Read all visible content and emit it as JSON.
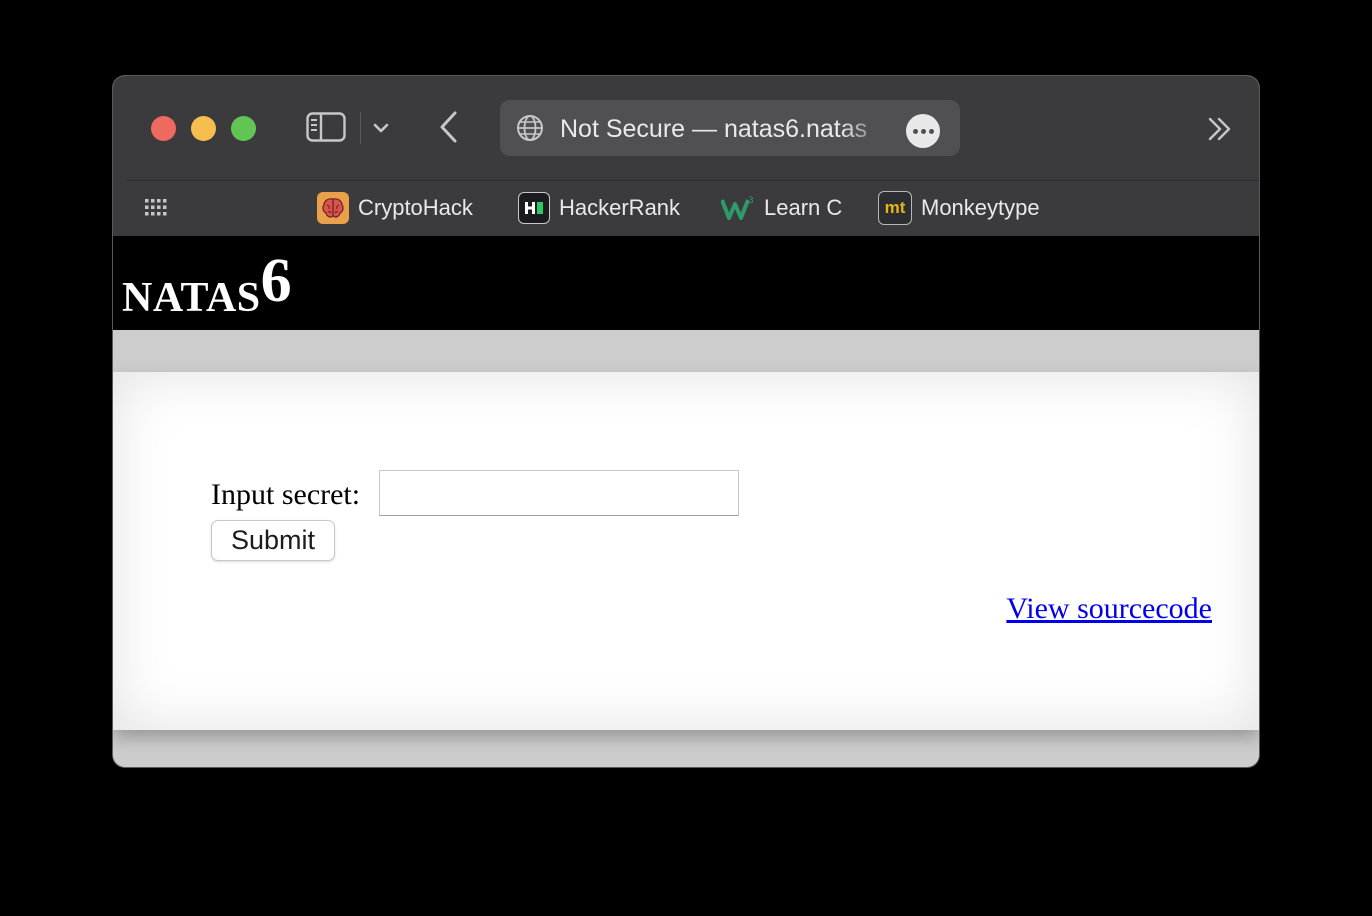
{
  "browser": {
    "address_text": "Not Secure — natas6.natas",
    "bookmarks": [
      {
        "label": "CryptoHack",
        "icon": "cryptohack-favicon"
      },
      {
        "label": "HackerRank",
        "icon": "hackerrank-favicon"
      },
      {
        "label": "Learn C",
        "icon": "learn-c-favicon"
      },
      {
        "label": "Monkeytype",
        "icon": "monkeytype-favicon",
        "icon_text": "mt"
      }
    ],
    "colors": {
      "toolbar": "#3b3b3d",
      "address_bar": "#505052",
      "traffic_red": "#ee6a5e",
      "traffic_yellow": "#f5be4f",
      "traffic_green": "#61c454"
    }
  },
  "page": {
    "title_prefix": "NATAS",
    "title_number": "6",
    "form": {
      "label": "Input secret:",
      "input_value": "",
      "submit_label": "Submit"
    },
    "source_link": "View sourcecode",
    "colors": {
      "header_bg": "#000000",
      "link": "#0000ee",
      "body_bg": "#cdcdcd"
    }
  }
}
